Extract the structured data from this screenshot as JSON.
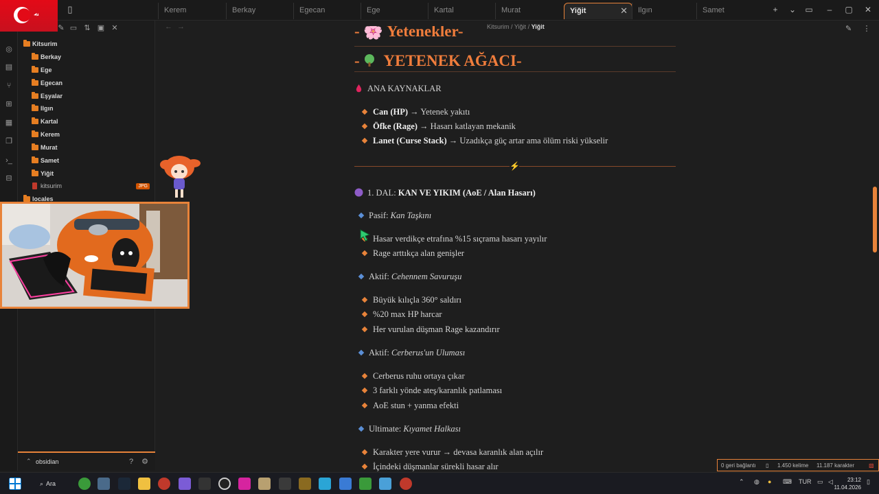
{
  "tabs": [
    {
      "label": "Kerem",
      "active": false
    },
    {
      "label": "Berkay",
      "active": false
    },
    {
      "label": "Egecan",
      "active": false
    },
    {
      "label": "Ege",
      "active": false
    },
    {
      "label": "Kartal",
      "active": false
    },
    {
      "label": "Murat",
      "active": false
    },
    {
      "label": "Yiğit",
      "active": true
    },
    {
      "label": "Ilgın",
      "active": false
    },
    {
      "label": "Samet",
      "active": false
    }
  ],
  "explorer": {
    "root": "Kitsurim",
    "folders": [
      "Berkay",
      "Ege",
      "Egecan",
      "Eşyalar",
      "Ilgın",
      "Kartal",
      "Kerem",
      "Murat",
      "Samet",
      "Yiğit"
    ],
    "file": {
      "name": "kitsurim",
      "badge": "JPG"
    },
    "partial": "locales",
    "vault": "obsidian"
  },
  "breadcrumb": {
    "root": "Kitsurim",
    "middle": "Yiğit",
    "current": "Yiğit"
  },
  "note": {
    "partial_heading": "- 🌸 Yetenekler-",
    "heading_prefix": "- ",
    "heading_text": "YETENEK AĞACI-",
    "resources_title": "ANA KAYNAKLAR",
    "resources": [
      {
        "bold": "Can (HP)",
        "rest": " → Yetenek yakıtı"
      },
      {
        "bold": "Öfke (Rage)",
        "rest": " → Hasarı katlayan mekanik"
      },
      {
        "bold": "Lanet (Curse Stack)",
        "rest": " → Uzadıkça güç artar ama ölüm riski yükselir"
      }
    ],
    "divider_symbol": "⚡",
    "branch_prefix": "1. DAL: ",
    "branch_bold": "KAN VE YIKIM (AoE / Alan Hasarı)",
    "passive_label": "Pasif: ",
    "passive_name": "Kan Taşkını",
    "passive_items": [
      "Hasar verdikçe etrafına %15 sıçrama hasarı yayılır",
      "Rage arttıkça alan genişler"
    ],
    "active1_label": "Aktif: ",
    "active1_name": "Cehennem Savuruşu",
    "active1_items": [
      "Büyük kılıçla 360° saldırı",
      "%20 max HP harcar",
      "Her vurulan düşman Rage kazandırır"
    ],
    "active2_label": "Aktif: ",
    "active2_name": "Cerberus'un Uluması",
    "active2_items": [
      "Cerberus ruhu ortaya çıkar",
      "3 farklı yönde ateş/karanlık patlaması",
      "AoE stun + yanma efekti"
    ],
    "ult_label": "Ultimate: ",
    "ult_name": "Kıyamet Halkası",
    "ult_items": [
      "Karakter yere vurur → devasa karanlık alan açılır",
      "İçindeki düşmanlar sürekli hasar alır"
    ]
  },
  "status": {
    "backlinks": "0 geri bağlantı",
    "words": "1.450 kelime",
    "chars": "11.187 karakter"
  },
  "taskbar": {
    "search": "Ara",
    "lang": "TUR",
    "time": "23:12",
    "date": "11.04.2026"
  },
  "colors": {
    "accent": "#e8833a",
    "heading": "#f07d3c",
    "flag": "#e30a17"
  }
}
